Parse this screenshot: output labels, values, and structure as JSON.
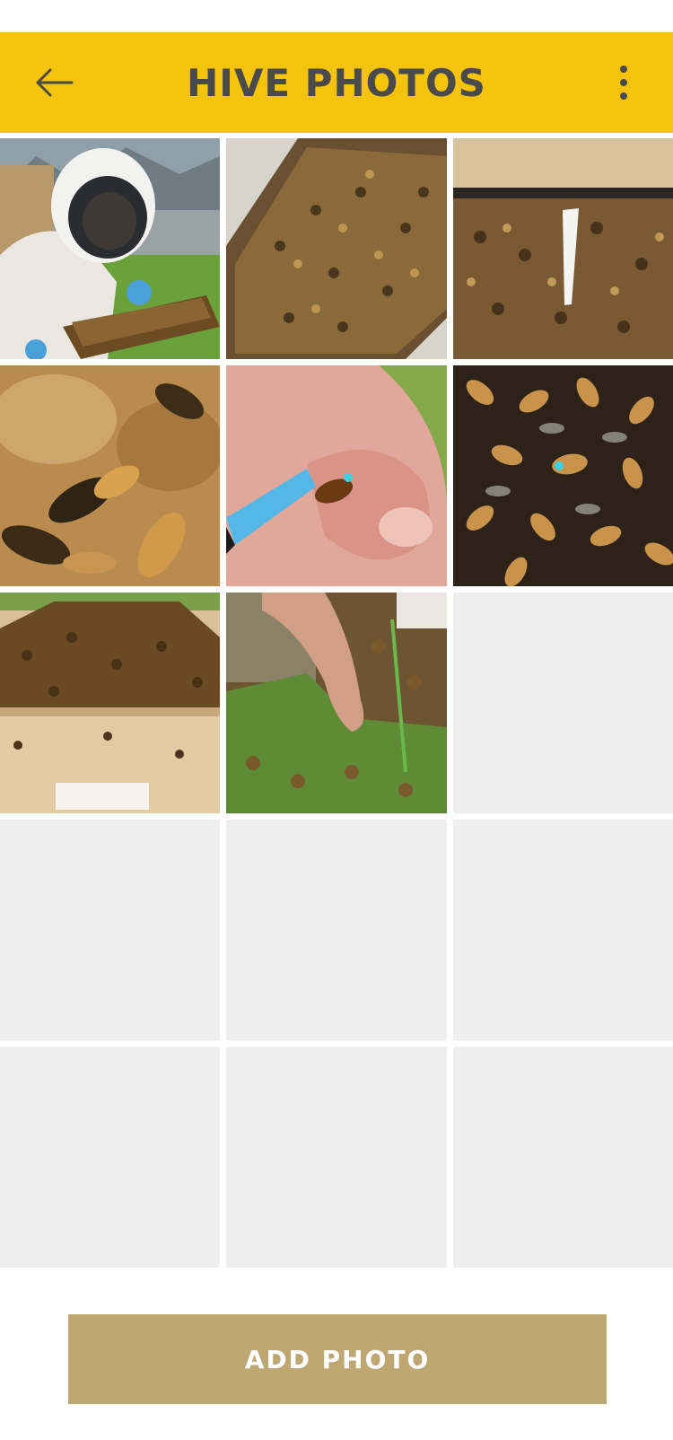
{
  "header": {
    "title": "HIVE PHOTOS",
    "back_icon": "arrow-left-icon",
    "menu_icon": "more-vertical-icon",
    "background": "#F3C30D",
    "text_color": "#4a4a4a"
  },
  "photos": [
    {
      "content": "beekeeper-in-veil-holding-frame"
    },
    {
      "content": "frame-covered-with-bees"
    },
    {
      "content": "bees-on-hive-with-white-marker"
    },
    {
      "content": "close-up-honey-bees"
    },
    {
      "content": "hand-marking-queen-bee-with-blue-pen"
    },
    {
      "content": "dense-cluster-of-bees"
    },
    {
      "content": "wooden-hive-box-with-bees"
    },
    {
      "content": "hand-touching-bees-in-grass"
    },
    {
      "content": "empty-slot"
    },
    {
      "content": "empty-slot"
    },
    {
      "content": "empty-slot"
    },
    {
      "content": "empty-slot"
    },
    {
      "content": "empty-slot"
    },
    {
      "content": "empty-slot"
    },
    {
      "content": "empty-slot"
    }
  ],
  "actions": {
    "add_photo_label": "ADD PHOTO",
    "button_color": "#BEA771"
  }
}
